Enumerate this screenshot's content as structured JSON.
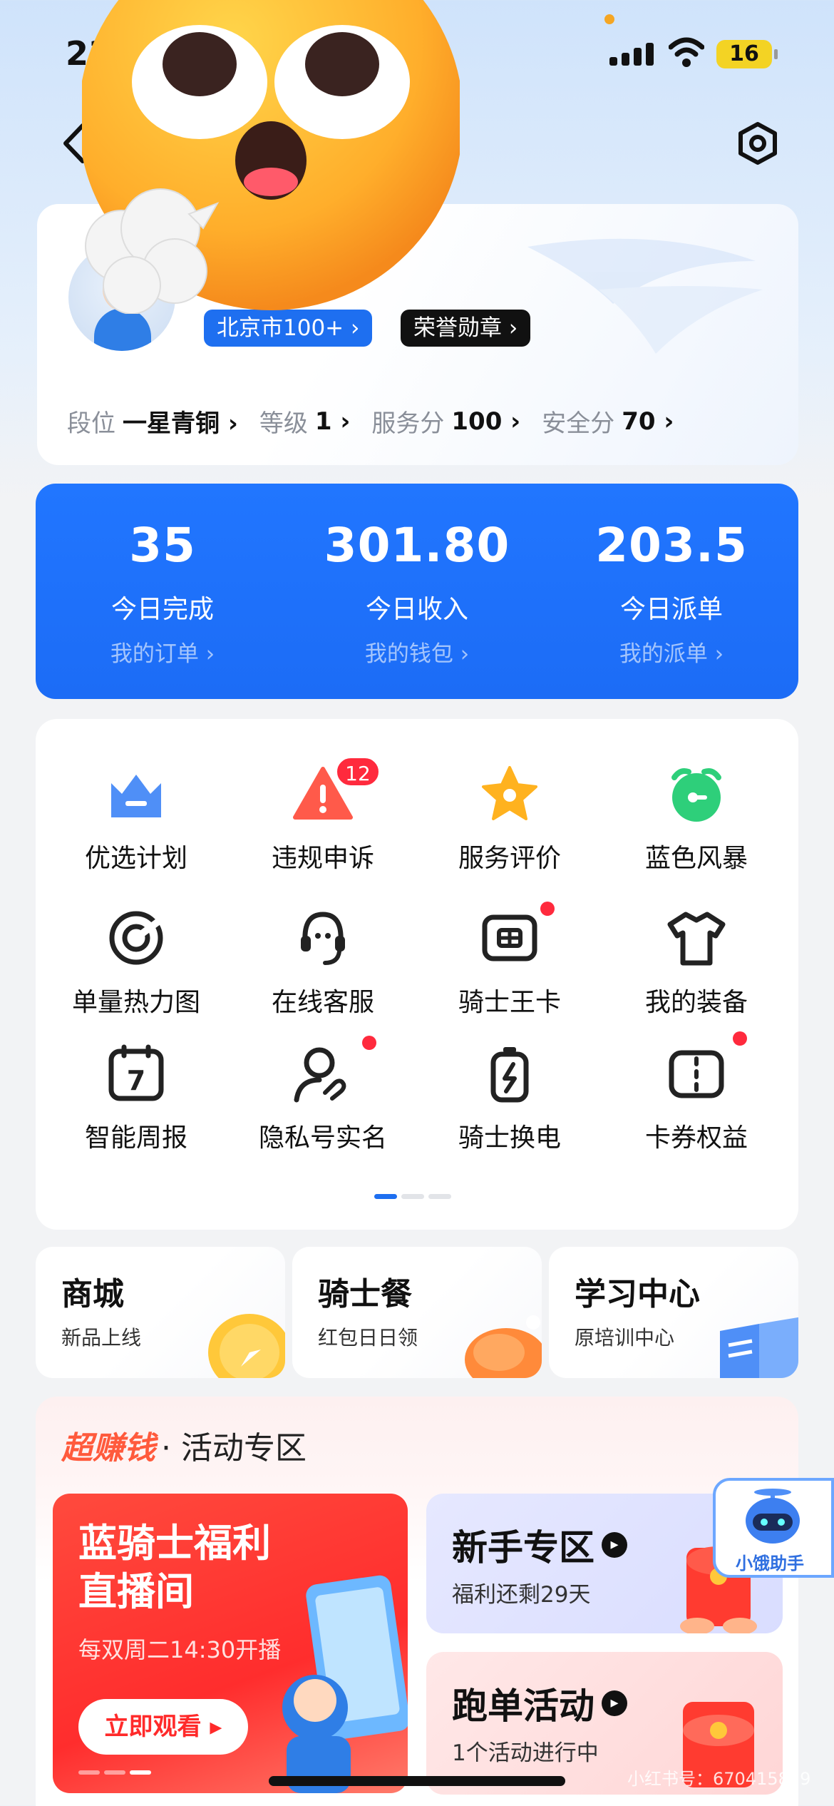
{
  "status_bar": {
    "time": "23",
    "battery": "16"
  },
  "profile": {
    "city_badge": "北京市100+ ›",
    "honor_badge": "荣誉勋章 ›",
    "stats": [
      {
        "label": "段位",
        "value": "一星青铜 ›"
      },
      {
        "label": "等级",
        "value": "1 ›"
      },
      {
        "label": "服务分",
        "value": "100 ›"
      },
      {
        "label": "安全分",
        "value": "70 ›"
      }
    ]
  },
  "summary": [
    {
      "value": "35",
      "label": "今日完成",
      "link": "我的订单 ›"
    },
    {
      "value": "301.80",
      "label": "今日收入",
      "link": "我的钱包 ›"
    },
    {
      "value": "203.5",
      "label": "今日派单",
      "link": "我的派单 ›"
    }
  ],
  "grid": [
    {
      "label": "优选计划",
      "icon": "crown-icon"
    },
    {
      "label": "违规申诉",
      "icon": "warning-icon",
      "badge": "12"
    },
    {
      "label": "服务评价",
      "icon": "star-icon"
    },
    {
      "label": "蓝色风暴",
      "icon": "alarm-icon"
    },
    {
      "label": "单量热力图",
      "icon": "target-icon"
    },
    {
      "label": "在线客服",
      "icon": "headset-icon"
    },
    {
      "label": "骑士王卡",
      "icon": "sim-card-icon",
      "dot": true
    },
    {
      "label": "我的装备",
      "icon": "tshirt-icon"
    },
    {
      "label": "智能周报",
      "icon": "calendar-icon",
      "calendar_day": "7"
    },
    {
      "label": "隐私号实名",
      "icon": "user-verify-icon",
      "dot": true
    },
    {
      "label": "骑士换电",
      "icon": "battery-swap-icon"
    },
    {
      "label": "卡券权益",
      "icon": "coupon-icon",
      "dot": true
    }
  ],
  "shortcuts": [
    {
      "title": "商城",
      "subtitle": "新品上线"
    },
    {
      "title": "骑士餐",
      "subtitle": "红包日日领"
    },
    {
      "title": "学习中心",
      "subtitle": "原培训中心"
    }
  ],
  "activity": {
    "heading_hot": "超赚钱",
    "heading_rest": "· 活动专区",
    "live": {
      "title": "蓝骑士福利直播间",
      "subtitle": "每双周二14:30开播",
      "button": "立即观看 ▸"
    },
    "newbie": {
      "title": "新手专区",
      "subtitle": "福利还剩29天"
    },
    "running": {
      "title": "跑单活动",
      "subtitle": "1个活动进行中"
    }
  },
  "assistant_label": "小饿助手",
  "watermark": "小红书号：670415829",
  "colors": {
    "primary_blue": "#1e6ff0",
    "alert_red": "#ff2a3d",
    "activity_red": "#ff5a3c"
  }
}
